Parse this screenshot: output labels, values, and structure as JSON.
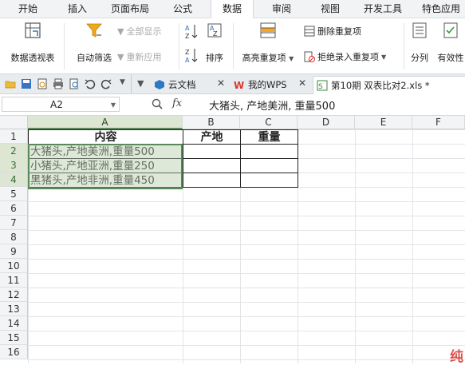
{
  "ribbon_tabs": [
    "开始",
    "插入",
    "页面布局",
    "公式",
    "数据",
    "审阅",
    "视图",
    "开发工具",
    "特色应用"
  ],
  "active_tab": "数据",
  "ribbon": {
    "pivot_label": "数据透视表",
    "autofilter_label": "自动筛选",
    "show_all_label": "全部显示",
    "reapply_label": "重新应用",
    "sort_label": "排序",
    "highlight_dup_label": "高亮重复项",
    "remove_dup_label": "删除重复项",
    "reject_dup_label": "拒绝录入重复项",
    "split_label": "分列",
    "validity_label": "有效性"
  },
  "doc_tabs": [
    {
      "label": "云文档"
    },
    {
      "label": "我的WPS"
    },
    {
      "label": "第10期 双表比对2.xls *"
    }
  ],
  "formula_bar": {
    "name_box": "A2",
    "fx": "fx",
    "content": "大猪头, 产地美洲, 重量500"
  },
  "columns": [
    "A",
    "B",
    "C",
    "D",
    "E",
    "F"
  ],
  "rows": [
    "1",
    "2",
    "3",
    "4",
    "5",
    "6",
    "7",
    "8",
    "9",
    "10",
    "11",
    "12",
    "13",
    "14",
    "15",
    "16"
  ],
  "cells": {
    "a1": "内容",
    "b1": "产地",
    "c1": "重量",
    "a2": "大猪头,产地美洲,重量500",
    "a3": "小猪头,产地亚洲,重量250",
    "a4": "黑猪头,产地非洲,重量450"
  },
  "watermark": "纯",
  "colors": {
    "selection": "#5a8a5a",
    "accent_red": "#d9534f"
  }
}
